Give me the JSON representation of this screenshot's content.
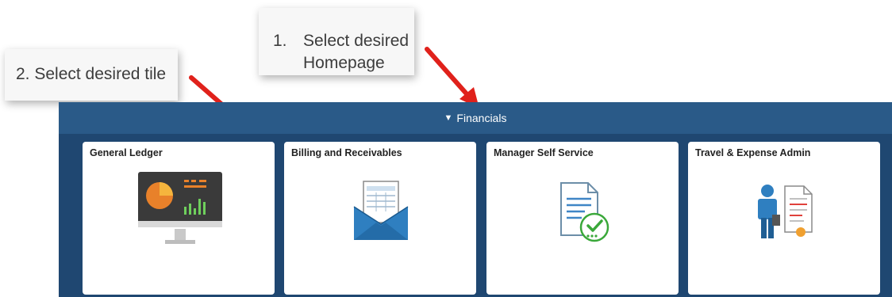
{
  "callouts": {
    "step1_number": "1.",
    "step1_line1": "Select desired",
    "step1_line2": "Homepage",
    "step2_text": "2. Select desired tile"
  },
  "homepage": {
    "title": "Financials",
    "dropdown_icon": "caret-down-icon"
  },
  "tiles": [
    {
      "title": "General Ledger",
      "icon": "monitor-chart-icon"
    },
    {
      "title": "Billing and Receivables",
      "icon": "envelope-invoice-icon"
    },
    {
      "title": "Manager Self Service",
      "icon": "document-checkmark-icon"
    },
    {
      "title": "Travel & Expense Admin",
      "icon": "person-document-icon"
    }
  ],
  "colors": {
    "panel": "#1f4771",
    "header": "#2a5a88",
    "arrow": "#e0211b"
  }
}
